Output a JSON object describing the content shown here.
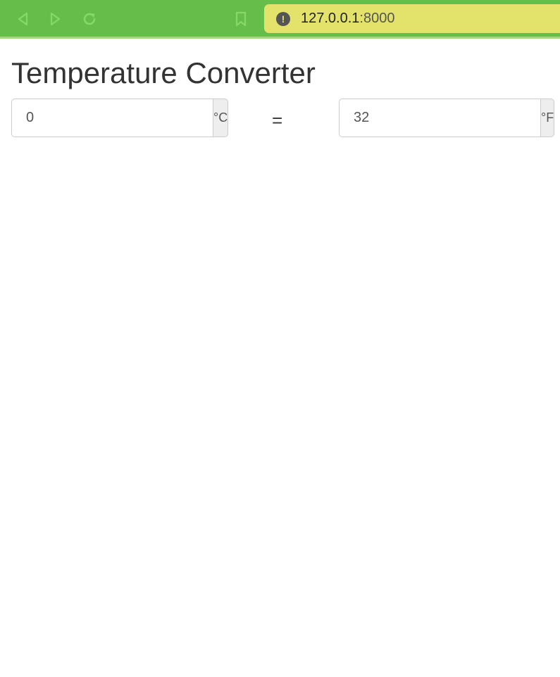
{
  "browser": {
    "url_host": "127.0.0.1",
    "url_port": ":8000",
    "icons": {
      "back": "back-arrow-icon",
      "forward": "forward-arrow-icon",
      "reload": "reload-icon",
      "bookmark": "bookmark-icon",
      "warning": "warning-icon"
    },
    "warning_glyph": "!",
    "colors": {
      "toolbar": "#67bd4a",
      "url_bar": "#e3e36b",
      "icon": "#86d86a"
    }
  },
  "page": {
    "title": "Temperature Converter",
    "celsius": {
      "value": "0",
      "unit": "°C"
    },
    "equals": "=",
    "fahrenheit": {
      "value": "32",
      "unit": "°F"
    }
  }
}
